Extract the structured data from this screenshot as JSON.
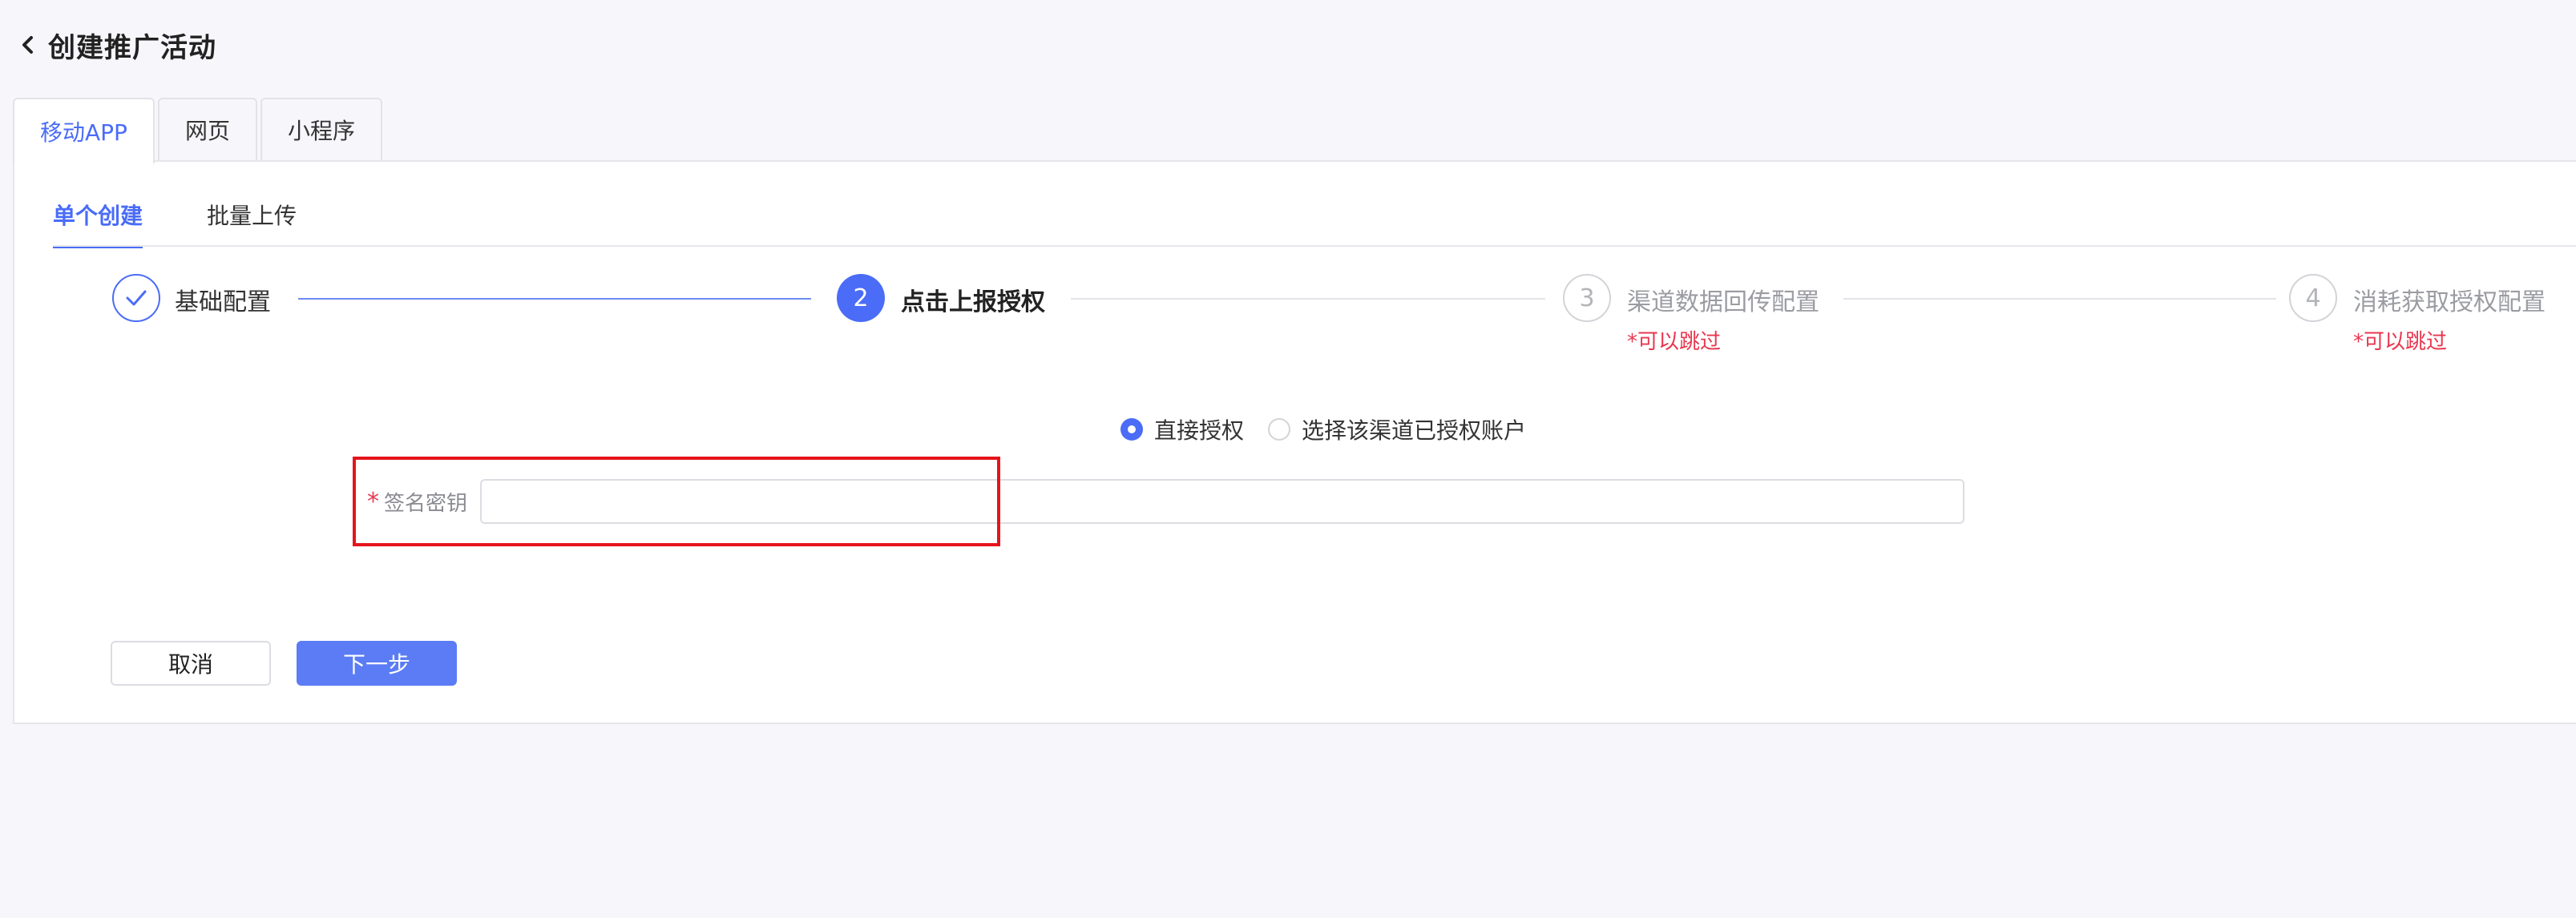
{
  "header": {
    "title": "创建推广活动",
    "back_icon": "chevron-left-icon"
  },
  "top_tabs": [
    "移动APP",
    "网页",
    "小程序"
  ],
  "sub_tabs": [
    "单个创建",
    "批量上传"
  ],
  "steps": [
    {
      "label": "基础配置",
      "state": "done",
      "number": "",
      "icon": "check-icon"
    },
    {
      "label": "点击上报授权",
      "state": "active",
      "number": "2"
    },
    {
      "label": "渠道数据回传配置",
      "state": "todo",
      "number": "3",
      "note": "*可以跳过"
    },
    {
      "label": "消耗获取授权配置",
      "state": "todo",
      "number": "4",
      "note": "*可以跳过"
    }
  ],
  "auth_options": [
    {
      "label": "直接授权",
      "checked": true
    },
    {
      "label": "选择该渠道已授权账户",
      "checked": false
    }
  ],
  "form": {
    "required_mark": "*",
    "signature_label": "签名密钥",
    "signature_value": ""
  },
  "buttons": {
    "cancel": "取消",
    "next": "下一步"
  },
  "colors": {
    "accent": "#4a6cf7",
    "warning": "#e8374f",
    "highlight": "#e5141c"
  }
}
